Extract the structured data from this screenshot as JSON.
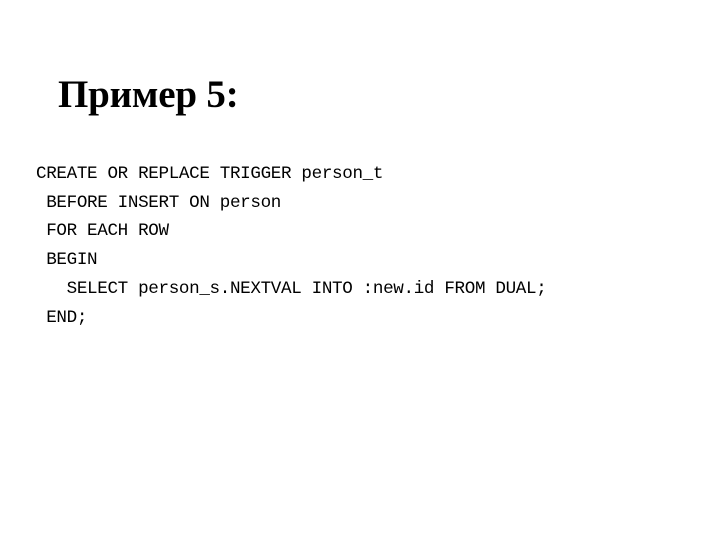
{
  "slide": {
    "title": "Пример 5:",
    "background_color": "#ffffff",
    "text_color": "#000000",
    "code": {
      "language": "PL/SQL",
      "lines": [
        "CREATE OR REPLACE TRIGGER person_t",
        " BEFORE INSERT ON person",
        " FOR EACH ROW",
        " BEGIN",
        "   SELECT person_s.NEXTVAL INTO :new.id FROM DUAL;",
        " END;"
      ]
    }
  }
}
